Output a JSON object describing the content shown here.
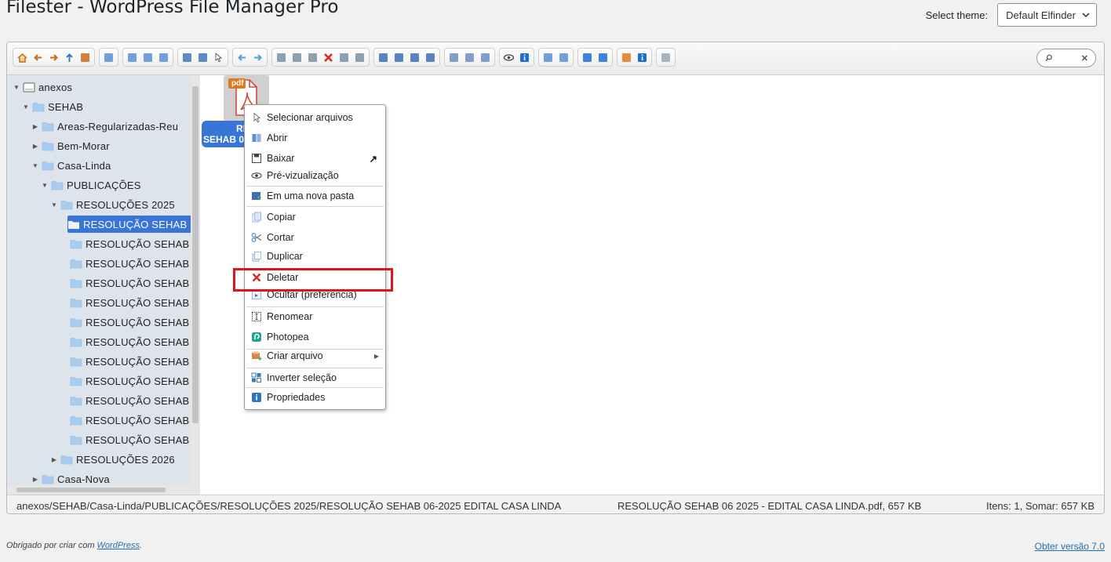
{
  "header": {
    "title": "Filester - WordPress File Manager Pro",
    "theme_label": "Select theme:",
    "theme_value": "Default Elfinder"
  },
  "search": {
    "placeholder": ""
  },
  "tree": [
    {
      "label": "anexos",
      "level": 0,
      "expanded": true,
      "type": "drive"
    },
    {
      "label": "SEHAB",
      "level": 1,
      "expanded": true
    },
    {
      "label": "Areas-Regularizadas-Reu",
      "level": 2,
      "expanded": false
    },
    {
      "label": "Bem-Morar",
      "level": 2,
      "expanded": false
    },
    {
      "label": "Casa-Linda",
      "level": 2,
      "expanded": true
    },
    {
      "label": "PUBLICAÇÕES",
      "level": 3,
      "expanded": true
    },
    {
      "label": "RESOLUÇÕES 2025",
      "level": 4,
      "expanded": true
    },
    {
      "label": "RESOLUÇÃO SEHAB",
      "level": 5,
      "selected": true
    },
    {
      "label": "RESOLUÇÃO SEHAB",
      "level": 5
    },
    {
      "label": "RESOLUÇÃO SEHAB",
      "level": 5
    },
    {
      "label": "RESOLUÇÃO SEHAB",
      "level": 5
    },
    {
      "label": "RESOLUÇÃO SEHAB",
      "level": 5
    },
    {
      "label": "RESOLUÇÃO SEHAB",
      "level": 5
    },
    {
      "label": "RESOLUÇÃO SEHAB",
      "level": 5
    },
    {
      "label": "RESOLUÇÃO SEHAB",
      "level": 5
    },
    {
      "label": "RESOLUÇÃO SEHAB",
      "level": 5
    },
    {
      "label": "RESOLUÇÃO SEHAB",
      "level": 5
    },
    {
      "label": "RESOLUÇÃO SEHAB",
      "level": 5
    },
    {
      "label": "RESOLUÇÃO SEHAB",
      "level": 5
    },
    {
      "label": "RESOLUÇÕES 2026",
      "level": 4,
      "expanded": false
    },
    {
      "label": "Casa-Nova",
      "level": 2,
      "expanded": false
    }
  ],
  "file": {
    "badge": "pdf",
    "label_line1": "RESO",
    "label_line2": "SEHAB 0"
  },
  "context_menu": [
    {
      "label": "Selecionar arquivos",
      "icon": "cursor-icon"
    },
    {
      "label": "Abrir",
      "icon": "open-book-icon"
    },
    {
      "label": "Baixar",
      "icon": "save-icon",
      "extra": "↗"
    },
    {
      "label": "Pré-vizualização",
      "icon": "eye-icon"
    },
    {
      "label": "Em uma nova pasta",
      "icon": "new-folder-icon"
    },
    {
      "label": "Copiar",
      "icon": "copy-icon"
    },
    {
      "label": "Cortar",
      "icon": "scissors-icon"
    },
    {
      "label": "Duplicar",
      "icon": "duplicate-icon"
    },
    {
      "label": "Deletar",
      "icon": "delete-x-icon"
    },
    {
      "label": "Ocultar (preferência)",
      "icon": "hide-icon"
    },
    {
      "label": "Renomear",
      "icon": "rename-icon"
    },
    {
      "label": "Photopea",
      "icon": "photopea-icon"
    },
    {
      "label": "Criar arquivo",
      "icon": "create-file-icon",
      "submenu": true
    },
    {
      "label": "Inverter seleção",
      "icon": "invert-selection-icon"
    },
    {
      "label": "Propriedades",
      "icon": "info-icon"
    }
  ],
  "status": {
    "path": "anexos/SEHAB/Casa-Linda/PUBLICAÇÕES/RESOLUÇÕES 2025/RESOLUÇÃO SEHAB 06-2025 EDITAL CASA LINDA",
    "file": "RESOLUÇÃO SEHAB 06 2025 - EDITAL CASA LINDA.pdf, 657 KB",
    "sum": "Itens: 1, Somar: 657 KB"
  },
  "footer": {
    "prefix": "Obrigado por criar com ",
    "link": "WordPress",
    "suffix": ".",
    "right": "Obter versão 7.0"
  },
  "colors": {
    "selection": "#3875d7",
    "tree_bg": "#dde4eb",
    "highlight": "#e0141d"
  }
}
